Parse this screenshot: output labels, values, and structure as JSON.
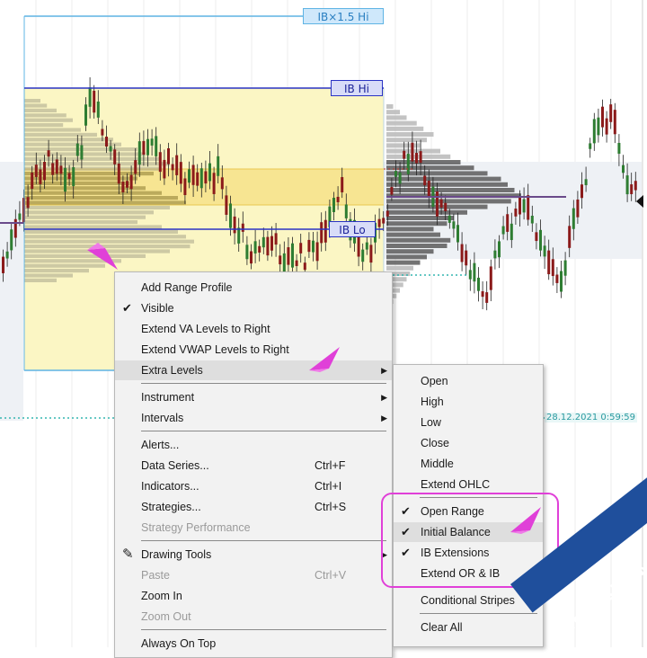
{
  "chart": {
    "levels": {
      "ib_15_hi": "IB×1.5 Hi",
      "ib_hi": "IB Hi",
      "ib_lo": "IB Lo"
    },
    "timestamp": "28.12.2021 0:59:59",
    "colors": {
      "ib_fill": "#fbf6c4",
      "value_area": "#f6e28a",
      "ib_line": "#2a33c4",
      "ib15_line": "#5fb4e4",
      "bull_candle": "#2e7d32",
      "bear_candle": "#8b1a1a",
      "profile": "#9a9a9a",
      "dotted_level": "#35b6b0"
    }
  },
  "context_menu": {
    "items": [
      {
        "label": "Add Range Profile",
        "checked": false
      },
      {
        "label": "Visible",
        "checked": true
      },
      {
        "label": "Extend VA Levels to Right",
        "checked": false
      },
      {
        "label": "Extend VWAP Levels to Right",
        "checked": false
      },
      {
        "label": "Extra Levels",
        "has_submenu": true,
        "highlighted": true
      },
      {
        "label": "Instrument",
        "has_submenu": true
      },
      {
        "label": "Intervals",
        "has_submenu": true
      },
      {
        "label": "Alerts..."
      },
      {
        "label": "Data Series...",
        "shortcut": "Ctrl+F"
      },
      {
        "label": "Indicators...",
        "shortcut": "Ctrl+I"
      },
      {
        "label": "Strategies...",
        "shortcut": "Ctrl+S"
      },
      {
        "label": "Strategy Performance",
        "disabled": true
      },
      {
        "label": "Drawing Tools",
        "has_submenu": true,
        "icon": "pencil-icon"
      },
      {
        "label": "Paste",
        "shortcut": "Ctrl+V",
        "disabled": true
      },
      {
        "label": "Zoom In"
      },
      {
        "label": "Zoom Out",
        "disabled": true
      },
      {
        "label": "Always On Top"
      }
    ]
  },
  "submenu": {
    "items": [
      {
        "label": "Open"
      },
      {
        "label": "High"
      },
      {
        "label": "Low"
      },
      {
        "label": "Close"
      },
      {
        "label": "Middle"
      },
      {
        "label": "Extend OHLC"
      },
      {
        "label": "Open Range",
        "checked": true
      },
      {
        "label": "Initial Balance",
        "checked": true,
        "highlighted": true
      },
      {
        "label": "IB Extensions",
        "checked": true
      },
      {
        "label": "Extend OR & IB"
      },
      {
        "label": "Conditional Stripes"
      },
      {
        "label": "Clear All"
      }
    ]
  },
  "watermark": {
    "text": "FuturesFlow.io"
  },
  "annotation_color": "#e040d8"
}
